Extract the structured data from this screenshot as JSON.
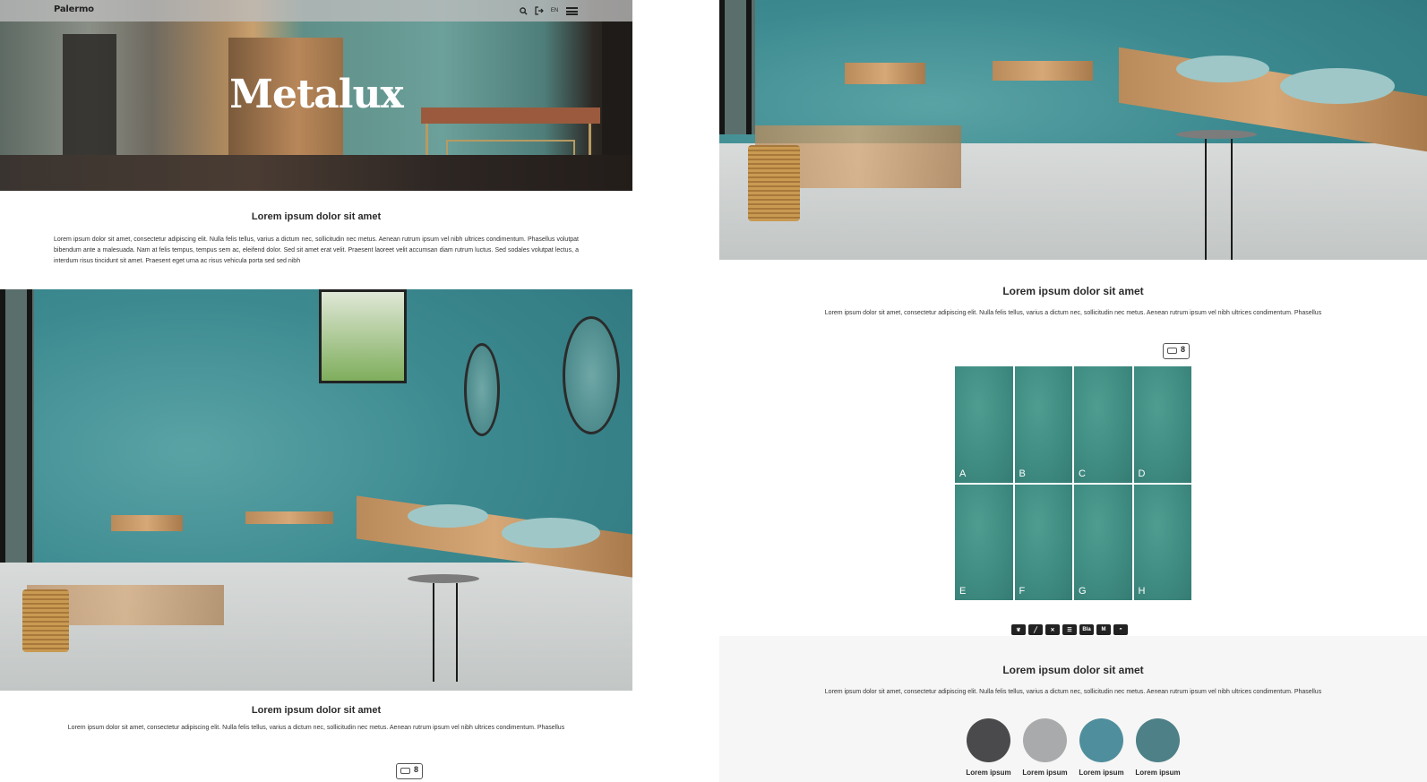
{
  "left_page": {
    "header": {
      "logo_text": "Palermo",
      "lang": "EN",
      "icons": [
        "search-icon",
        "login-icon",
        "menu-icon"
      ]
    },
    "hero": {
      "title": "Metalux"
    },
    "intro": {
      "title": "Lorem ipsum dolor sit amet",
      "text": "Lorem ipsum dolor sit amet, consectetur adipiscing elit. Nulla felis tellus, varius a dictum nec, sollicitudin nec metus. Aenean rutrum ipsum vel nibh ultrices condimentum. Phasellus volutpat bibendum ante a malesuada. Nam at felis tempus, tempus sem ac, eleifend dolor. Sed sit amet erat velit. Praesent laoreet velit accumsan diam rutrum luctus. Sed sodales volutpat lectus, a interdum risus tincidunt sit amet. Praesent eget urna ac risus vehicula porta sed sed nibh"
    },
    "section2": {
      "title": "Lorem ipsum dolor sit amet",
      "text": "Lorem ipsum dolor sit amet, consectetur adipiscing elit. Nulla felis tellus, varius a dictum nec, sollicitudin nec metus. Aenean rutrum ipsum vel nibh ultrices condimentum. Phasellus",
      "badge_number": "8"
    }
  },
  "right_page": {
    "section1": {
      "title": "Lorem ipsum dolor sit amet",
      "text": "Lorem ipsum dolor sit amet, consectetur adipiscing elit. Nulla felis tellus, varius a dictum nec, sollicitudin nec metus. Aenean rutrum ipsum vel nibh ultrices condimentum. Phasellus",
      "badge_number": "8"
    },
    "tiles": [
      "A",
      "B",
      "C",
      "D",
      "E",
      "F",
      "G",
      "H"
    ],
    "features": [
      "leaf-icon",
      "brush-icon",
      "cross-icon",
      "list-icon",
      "Bla",
      "M",
      "drop-icon"
    ],
    "section2": {
      "title": "Lorem ipsum dolor sit amet",
      "text": "Lorem ipsum dolor sit amet, consectetur adipiscing elit. Nulla felis tellus, varius a dictum nec, sollicitudin nec metus. Aenean rutrum ipsum vel nibh ultrices condimentum. Phasellus"
    },
    "swatches": [
      {
        "label": "Lorem ipsum",
        "color": "#4a4a4c"
      },
      {
        "label": "Lorem ipsum",
        "color": "#a9aaab"
      },
      {
        "label": "Lorem ipsum",
        "color": "#4f8e9c"
      },
      {
        "label": "Lorem ipsum",
        "color": "#4e8087"
      }
    ]
  }
}
